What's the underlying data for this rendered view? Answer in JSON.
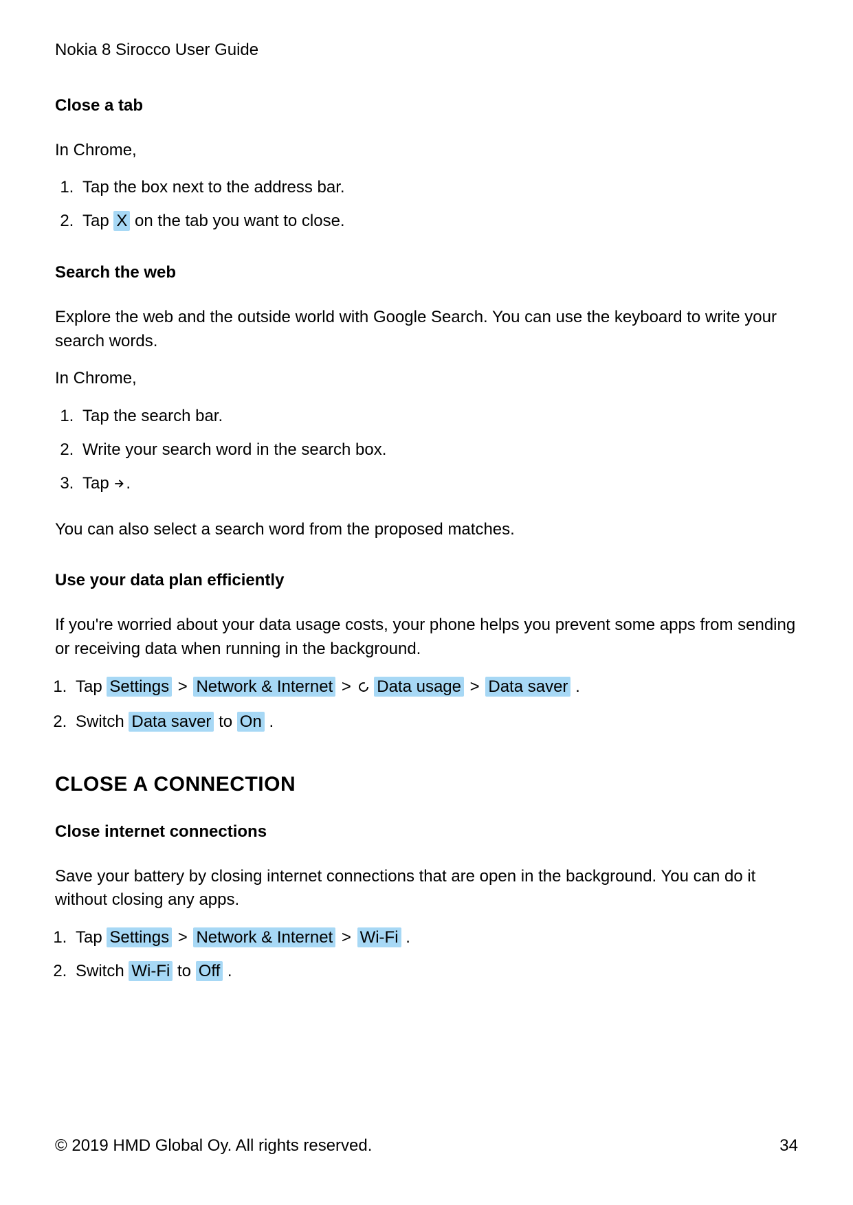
{
  "header": {
    "title": "Nokia 8 Sirocco User Guide"
  },
  "sections": {
    "close_tab": {
      "heading": "Close a tab",
      "intro": "In Chrome,",
      "step1": "Tap the box next to the address bar.",
      "step2_pre": "Tap ",
      "step2_hl": "X",
      "step2_post": " on the tab you want to close."
    },
    "search_web": {
      "heading": "Search the web",
      "intro1": "Explore the web and the outside world with Google Search. You can use the keyboard to write your search words.",
      "intro2": "In Chrome,",
      "step1": "Tap the search bar.",
      "step2": "Write your search word in the search box.",
      "step3_pre": "Tap ",
      "step3_post": ".",
      "outro": "You can also select a search word from the proposed matches."
    },
    "data_plan": {
      "heading": "Use your data plan efficiently",
      "intro": "If you're worried about your data usage costs, your phone helps you prevent some apps from sending or receiving data when running in the background.",
      "step1_pre": "Tap ",
      "step1_hl1": "Settings",
      "step1_hl2": "Network & Internet",
      "step1_hl3": "Data usage",
      "step1_hl4": "Data saver",
      "step1_post": " .",
      "step2_pre": "Switch ",
      "step2_hl1": "Data saver",
      "step2_mid": " to ",
      "step2_hl2": "On",
      "step2_post": " ."
    },
    "close_connection": {
      "h2": "CLOSE A CONNECTION",
      "heading": "Close internet connections",
      "intro": "Save your battery by closing internet connections that are open in the background. You can do it without closing any apps.",
      "step1_pre": "Tap ",
      "step1_hl1": "Settings",
      "step1_hl2": "Network & Internet",
      "step1_hl3": "Wi-Fi",
      "step1_post": " .",
      "step2_pre": "Switch ",
      "step2_hl1": "Wi-Fi",
      "step2_mid": " to ",
      "step2_hl2": "Off",
      "step2_post": " ."
    }
  },
  "separator": ">",
  "footer": {
    "copyright": "© 2019 HMD Global Oy. All rights reserved.",
    "page_number": "34"
  }
}
